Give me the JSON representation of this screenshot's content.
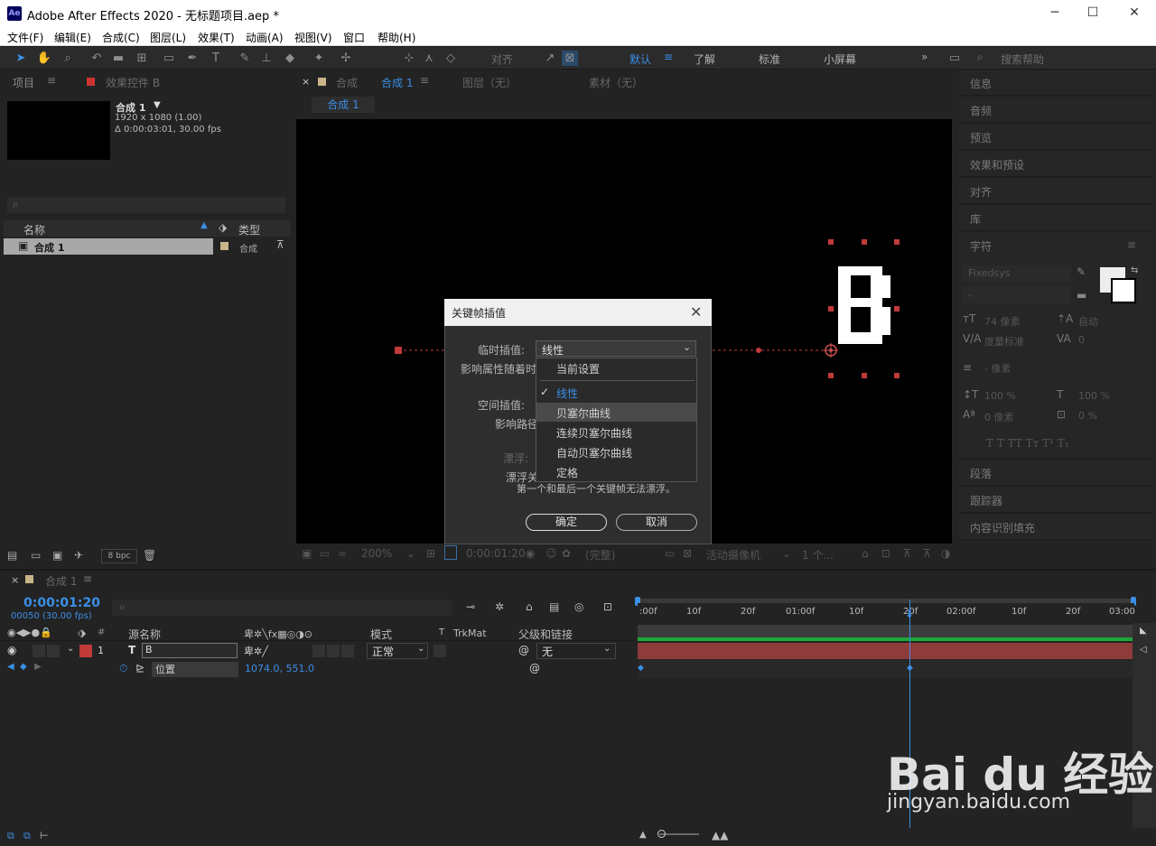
{
  "window": {
    "title": "Adobe After Effects 2020 - 无标题项目.aep *",
    "logo": "Ae",
    "min": "─",
    "max": "☐",
    "close": "✕"
  },
  "menu": [
    "文件(F)",
    "编辑(E)",
    "合成(C)",
    "图层(L)",
    "效果(T)",
    "动画(A)",
    "视图(V)",
    "窗口",
    "帮助(H)"
  ],
  "toolbar": {
    "snap_label": "对齐",
    "workspaces": [
      "默认",
      "了解",
      "标准",
      "小屏幕"
    ],
    "search_placeholder": "搜索帮助"
  },
  "project": {
    "tab_project": "项目",
    "tab_effects": "效果控件 B",
    "comp_name": "合成 1",
    "comp_size": "1920 x 1080 (1.00)",
    "comp_dur": "Δ 0:00:03:01, 30.00 fps",
    "col_name": "名称",
    "col_type": "类型",
    "row_name": "合成 1",
    "row_type": "合成",
    "bpc": "8 bpc"
  },
  "comp": {
    "tab_label": "合成",
    "tab_comp": "合成 1",
    "tab_layer": "图层（无）",
    "tab_footage": "素材（无）",
    "sub_tab": "合成 1",
    "zoom": "200%",
    "time": "0:00:01:20",
    "quality": "(完整)",
    "camera": "活动摄像机",
    "views": "1 个..."
  },
  "right_panels": [
    "信息",
    "音频",
    "预览",
    "效果和预设",
    "对齐",
    "库",
    "字符"
  ],
  "char_panel": {
    "font": "Fixedsys",
    "style": "-",
    "size": "74 像素",
    "leading": "自动",
    "kerning": "度量标准",
    "tracking": "0",
    "stroke": "- 像素",
    "vscale": "100 %",
    "hscale": "100 %",
    "baseline": "0 像素",
    "tsume": "0 %",
    "styles": "T  T  TT  Tт  T¹  T₁"
  },
  "right_panels_bottom": [
    "段落",
    "跟踪器",
    "内容识别填充"
  ],
  "timeline": {
    "tab": "合成 1",
    "timecode": "0:00:01:20",
    "frames": "00050 (30.00 fps)",
    "col_source": "源名称",
    "col_mode": "模式",
    "col_t": "T",
    "col_trkmat": "TrkMat",
    "col_parent": "父级和链接",
    "layer_num": "1",
    "layer_type": "T",
    "layer_name": "B",
    "layer_mode": "正常",
    "layer_parent": "无",
    "prop_name": "位置",
    "prop_value": "1074.0, 551.0",
    "ruler": [
      ":00f",
      "10f",
      "20f",
      "01:00f",
      "10f",
      "20f",
      "02:00f",
      "10f",
      "20f",
      "03:00"
    ]
  },
  "dialog": {
    "title": "关键帧插值",
    "temporal_label": "临时插值:",
    "temporal_value": "线性",
    "affect_label": "影响属性随着时",
    "spatial_label": "空间插值:",
    "path_label": "影响路径",
    "float_label": "漂浮:",
    "float_label2": "漂浮关",
    "note": "第一个和最后一个关键帧无法漂浮。",
    "ok": "确定",
    "cancel": "取消",
    "dropdown": [
      "当前设置",
      "线性",
      "贝塞尔曲线",
      "连续贝塞尔曲线",
      "自动贝塞尔曲线",
      "定格"
    ],
    "checked": "✓"
  },
  "watermark": {
    "brand": "Bai du 经验",
    "url": "jingyan.baidu.com"
  }
}
